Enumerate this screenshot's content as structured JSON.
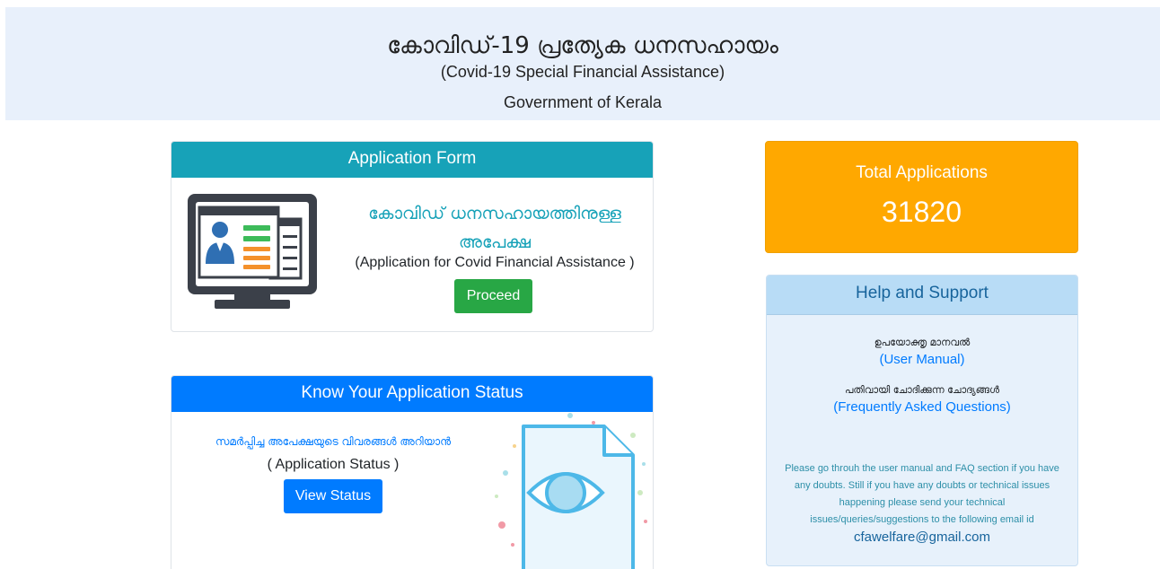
{
  "header": {
    "title_ml": "കോവിഡ്-19 പ്രത്യേക ധനസഹായം",
    "title_en": "(Covid-19 Special Financial Assistance)",
    "org": "Government of Kerala"
  },
  "application_form": {
    "heading": "Application Form",
    "title_ml": "കോവിഡ് ധനസഹായത്തിനുള്ള അപേക്ഷ",
    "subtitle": "(Application for Covid Financial Assistance )",
    "proceed_label": "Proceed",
    "icon": "computer-user-profile-icon"
  },
  "status": {
    "heading": "Know Your Application Status",
    "title_ml": "സമർപ്പിച്ച അപേക്ഷയുടെ വിവരങ്ങൾ അറിയാൻ",
    "subtitle": "( Application Status )",
    "button_label": "View Status",
    "icon": "document-eye-icon"
  },
  "totals": {
    "label": "Total Applications",
    "count": "31820"
  },
  "help": {
    "heading": "Help and Support",
    "manual_ml": "ഉപയോക്തൃ മാനവൽ",
    "manual_en": "(User Manual)",
    "faq_ml": "പതിവായി ചോദിക്കുന്ന ചോദ്യങ്ങൾ",
    "faq_en": "(Frequently Asked Questions)",
    "note": "Please go throuh the user manual and FAQ section if you have any doubts. Still if you have any doubts or technical issues happening please send your technical issues/queries/suggestions to the following email id",
    "email": "cfawelfare@gmail.com"
  },
  "colors": {
    "teal": "#17a2b8",
    "blue": "#007bff",
    "green": "#28a745",
    "orange": "#ffa800",
    "banner": "#e8f0fb"
  }
}
